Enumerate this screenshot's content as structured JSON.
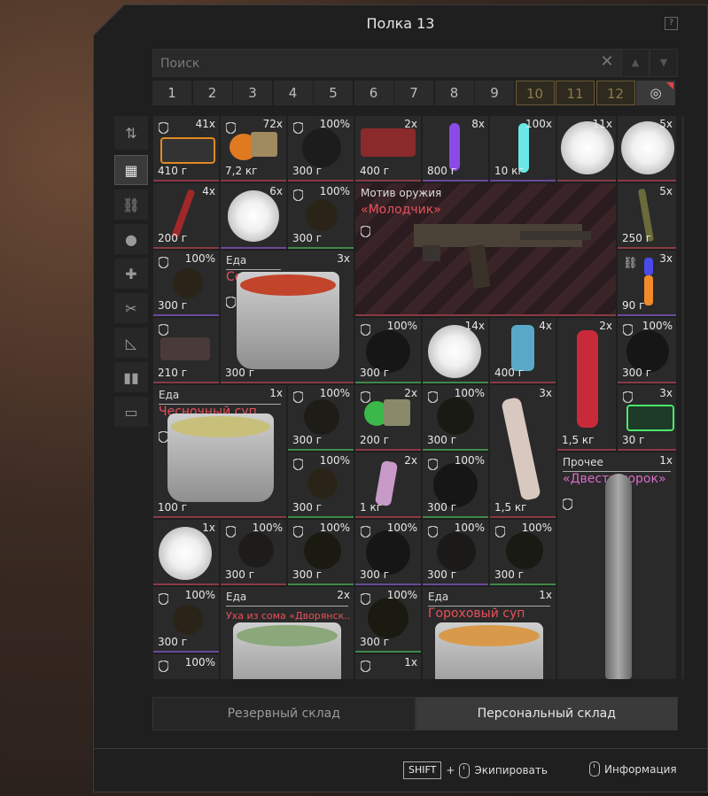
{
  "window": {
    "title": "Полка 13",
    "help_label": "?"
  },
  "search": {
    "placeholder": "Поиск",
    "value": ""
  },
  "pages": [
    "1",
    "2",
    "3",
    "4",
    "5",
    "6",
    "7",
    "8",
    "9",
    "10",
    "11",
    "12"
  ],
  "sidebar": [
    "sort-icon",
    "grid-icon",
    "chain-icon",
    "ball-icon",
    "medkit-icon",
    "tools-icon",
    "ruler-icon",
    "vest-icon",
    "archive-icon"
  ],
  "items": {
    "r1": [
      {
        "count": "41x",
        "weight": "410 г"
      },
      {
        "count": "72x",
        "weight": "7,2 кг"
      },
      {
        "count": "100%",
        "weight": "300 г"
      },
      {
        "count": "2x",
        "weight": "400 г"
      },
      {
        "count": "8x",
        "weight": "800 г"
      },
      {
        "count": "100x",
        "weight": "10 кг"
      },
      {
        "count": "11x",
        "weight": ""
      },
      {
        "count": "5x",
        "weight": ""
      }
    ],
    "r2": [
      {
        "count": "4x",
        "weight": "200 г"
      },
      {
        "count": "6x",
        "weight": ""
      },
      {
        "count": "100%",
        "weight": "300 г"
      },
      {
        "count": "5x",
        "weight": "250 г"
      }
    ],
    "weapon": {
      "category": "Мотив оружия",
      "name": "«Молодчик»"
    },
    "r3": [
      {
        "count": "100%",
        "weight": "300 г"
      },
      {
        "count": "3x",
        "weight": "90 г"
      }
    ],
    "soup1": {
      "category": "Еда",
      "name": "Солянка",
      "count": "3x",
      "weight": "300 г"
    },
    "r4": [
      {
        "count": "",
        "weight": "210 г"
      },
      {
        "count": "100%",
        "weight": "300 г"
      },
      {
        "count": "14x",
        "weight": ""
      },
      {
        "count": "4x",
        "weight": "400 г"
      },
      {
        "count": "2x",
        "weight": "1,5 кг"
      },
      {
        "count": "100%",
        "weight": "300 г"
      }
    ],
    "soup2": {
      "category": "Еда",
      "name": "Чесночный суп",
      "count": "1x",
      "weight": "100 г"
    },
    "r5": [
      {
        "count": "100%",
        "weight": "300 г"
      },
      {
        "count": "2x",
        "weight": "200 г"
      },
      {
        "count": "100%",
        "weight": "300 г"
      },
      {
        "count": "3x",
        "weight": "1,5 кг"
      },
      {
        "count": "3x",
        "weight": "30 г"
      }
    ],
    "other": {
      "category": "Прочее",
      "name": "«Двести сорок»",
      "count": "1x"
    },
    "r6": [
      {
        "count": "100%",
        "weight": "300 г"
      },
      {
        "count": "2x",
        "weight": "1 кг"
      },
      {
        "count": "100%",
        "weight": "300 г"
      }
    ],
    "r7": [
      {
        "count": "1x",
        "weight": ""
      },
      {
        "count": "100%",
        "weight": "300 г"
      },
      {
        "count": "100%",
        "weight": "300 г"
      },
      {
        "count": "100%",
        "weight": "300 г"
      },
      {
        "count": "100%",
        "weight": "300 г"
      },
      {
        "count": "100%",
        "weight": "300 г"
      }
    ],
    "r8": [
      {
        "count": "100%",
        "weight": "300 г"
      },
      {
        "count": "100%",
        "weight": "300 г"
      },
      {
        "count": "100%",
        "weight": ""
      },
      {
        "count": "1x",
        "weight": ""
      }
    ],
    "soup3": {
      "category": "Еда",
      "name": "Уха из сома «Дворянск..",
      "count": "2x"
    },
    "soup4": {
      "category": "Еда",
      "name": "Гороховый суп",
      "count": "1x"
    }
  },
  "tabs": {
    "reserve": "Резервный склад",
    "personal": "Персональный склад"
  },
  "hints": {
    "shift": "SHIFT",
    "plus": "+",
    "equip": "Экипировать",
    "info": "Информация"
  },
  "colors": {
    "accent_red": "#e8505a",
    "accent_pink": "#d86cc8",
    "gold": "#8f7a4d"
  }
}
